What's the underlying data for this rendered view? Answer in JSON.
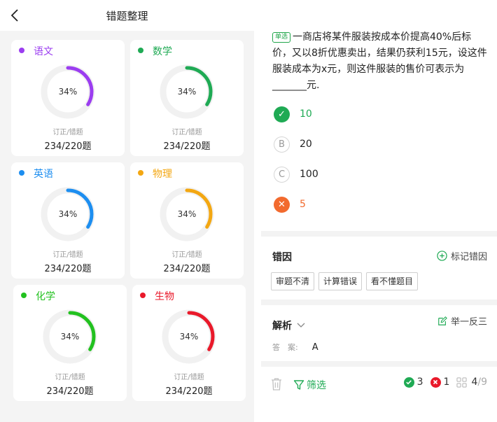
{
  "nav": {
    "title": "错题整理"
  },
  "cards": [
    {
      "subject": "语文",
      "color": "#9b3df0",
      "percent": "34%",
      "percent_value": 34,
      "label": "订正/错题",
      "value": "234/220题"
    },
    {
      "subject": "数学",
      "color": "#1faa54",
      "percent": "34%",
      "percent_value": 34,
      "label": "订正/错题",
      "value": "234/220题"
    },
    {
      "subject": "英语",
      "color": "#1d8ef0",
      "percent": "34%",
      "percent_value": 34,
      "label": "订正/错题",
      "value": "234/220题"
    },
    {
      "subject": "物理",
      "color": "#f3a712",
      "percent": "34%",
      "percent_value": 34,
      "label": "订正/错题",
      "value": "234/220题"
    },
    {
      "subject": "化学",
      "color": "#22c11f",
      "percent": "34%",
      "percent_value": 34,
      "label": "订正/错题",
      "value": "234/220题"
    },
    {
      "subject": "生物",
      "color": "#e9192a",
      "percent": "34%",
      "percent_value": 34,
      "label": "订正/错题",
      "value": "234/220题"
    }
  ],
  "question": {
    "tag": "单选",
    "text": "一商店将某件服装按成本价提高40%后标价，又以8折优惠卖出，结果仍获利15元，设这件服装成本为x元，则这件服装的售价可表示为_______元."
  },
  "options": [
    {
      "mark": "✓",
      "state": "correct",
      "text": "10",
      "color": "#1faa54"
    },
    {
      "mark": "B",
      "state": "plain",
      "text": "20",
      "color": "#222222"
    },
    {
      "mark": "C",
      "state": "plain",
      "text": "100",
      "color": "#222222"
    },
    {
      "mark": "✕",
      "state": "wrong",
      "text": "5",
      "color": "#f26a2e"
    }
  ],
  "error_cause": {
    "title": "错因",
    "action": "标记错因",
    "tags": [
      "审题不清",
      "计算错误",
      "看不懂题目"
    ]
  },
  "analysis": {
    "title": "解析",
    "action": "举一反三",
    "answer_label": "答　案:",
    "answer_value": "A"
  },
  "bottom": {
    "filter_label": "筛选",
    "correct_count": "3",
    "wrong_count": "1",
    "progress_current": "4",
    "progress_total": "/9"
  }
}
